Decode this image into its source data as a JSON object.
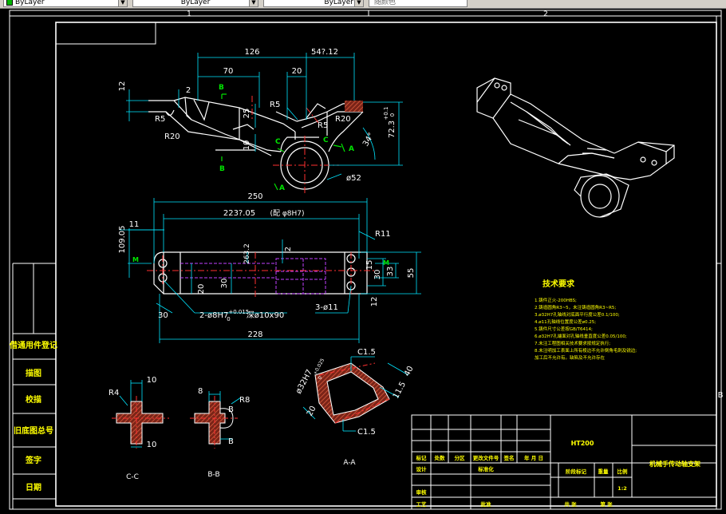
{
  "toolbar": {
    "color_value": "ByLayer",
    "linetype_value": "ByLayer",
    "lineweight_value": "ByLayer",
    "plotstyle_value": "随颜色"
  },
  "grid_labels": {
    "col1": "1",
    "col2": "2",
    "rowB": "B"
  },
  "top_view": {
    "dims": [
      "126",
      "54?.12",
      "70",
      "20",
      "12",
      "2",
      "25",
      "10",
      "R5",
      "R5",
      "R5",
      "R20",
      "R20",
      "72.3",
      "+0.1",
      "0",
      "34°",
      "ø52"
    ],
    "section_marks": [
      "B",
      "B",
      "C",
      "C",
      "A",
      "A"
    ]
  },
  "front_view": {
    "dims": [
      "250",
      "223?.05",
      "(配 φ8H7)",
      "11",
      "109.05",
      "263.2",
      "2",
      "R11",
      "15",
      "30",
      "20",
      "30",
      "33",
      "55",
      "12",
      "30",
      "228"
    ],
    "callouts": {
      "dowel_pre": "2-ø8H7",
      "dowel_tol_upper": "+0.015",
      "dowel_tol_lower": "0",
      "dowel_post": "深ø10x90",
      "holes": "3-ø11"
    },
    "section_marks": [
      "M",
      "M"
    ]
  },
  "aa_view": {
    "dims": [
      "C1.5",
      "C1.5",
      "ø32H7",
      "+0.025",
      "0",
      "20",
      "40",
      "11.5"
    ],
    "label": "A-A"
  },
  "cc_view": {
    "dims": [
      "R4",
      "10",
      "10"
    ],
    "label": "C-C"
  },
  "bb_view": {
    "dims": [
      "8",
      "R8",
      "B",
      "B"
    ],
    "label": "B-B"
  },
  "tech_requirements": {
    "title": "技术要求",
    "items": [
      "1.铸件正火-200HBS;",
      "2.铸造圆角R3~5，未注铸造圆角R3~R5;",
      "3.ø32H7孔轴线对底面平行度公差0.1/100;",
      "4.ø11孔轴线位置度公差ø0.25;",
      "5.铸件尺寸公差按GB/T6414;",
      "6.ø32H7孔端面对孔轴线垂直度公差0.05/100;",
      "7.未注工程图相关技术要求按规定执行;",
      "8.未注明加工表面上所有棱边不允许倒角毛刺及锐边;",
      "加工后不允许有。缺陷及不允许存在"
    ]
  },
  "left_stamps": [
    "借通用件登记",
    "描图",
    "校描",
    "旧底图总号",
    "签字",
    "日期"
  ],
  "title_block": {
    "material": "HT200",
    "part_name": "机械手传动轴支架",
    "header_cells": [
      "标记",
      "处数",
      "分区",
      "更改文件号",
      "签名",
      "年 月 日"
    ],
    "row_design": [
      "设计",
      "标准化"
    ],
    "row_review": "审核",
    "row_process": [
      "工艺",
      "批准"
    ],
    "stage_labels": [
      "阶段标记",
      "重量",
      "比例"
    ],
    "scale": "1:2",
    "sheet": [
      "共 张",
      "第 张"
    ]
  },
  "colors": {
    "background": "#000000",
    "outline": "#ffffff",
    "dimension": "#00e5ff",
    "text_dim": "#ffffff",
    "center": "#ff3030",
    "hidden": "#c040ff",
    "mark": "#00e500",
    "hatch": "#cc4030"
  }
}
